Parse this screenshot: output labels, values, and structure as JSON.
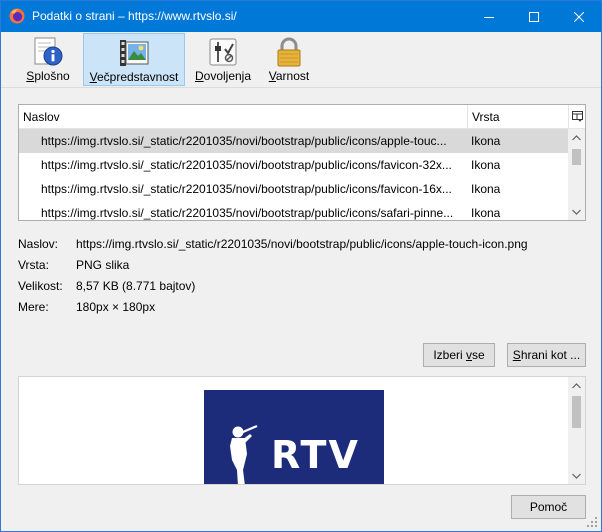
{
  "window": {
    "title": "Podatki o strani – https://www.rtvslo.si/",
    "accent": "#0078d7"
  },
  "tabs": [
    {
      "label_pre": "",
      "label_u": "S",
      "label_post": "plošno",
      "icon": "info-icon"
    },
    {
      "label_pre": "",
      "label_u": "V",
      "label_post": "ečpredstavnost",
      "icon": "media-icon"
    },
    {
      "label_pre": "",
      "label_u": "D",
      "label_post": "ovoljenja",
      "icon": "permissions-icon"
    },
    {
      "label_pre": "",
      "label_u": "V",
      "label_post": "arnost",
      "icon": "lock-icon"
    }
  ],
  "media_list": {
    "columns": [
      "Naslov",
      "Vrsta"
    ],
    "rows": [
      {
        "address": "https://img.rtvslo.si/_static/r2201035/novi/bootstrap/public/icons/apple-touc...",
        "type": "Ikona"
      },
      {
        "address": "https://img.rtvslo.si/_static/r2201035/novi/bootstrap/public/icons/favicon-32x...",
        "type": "Ikona"
      },
      {
        "address": "https://img.rtvslo.si/_static/r2201035/novi/bootstrap/public/icons/favicon-16x...",
        "type": "Ikona"
      },
      {
        "address": "https://img.rtvslo.si/_static/r2201035/novi/bootstrap/public/icons/safari-pinne...",
        "type": "Ikona"
      }
    ]
  },
  "details": {
    "address_label": "Naslov:",
    "address_value": "https://img.rtvslo.si/_static/r2201035/novi/bootstrap/public/icons/apple-touch-icon.png",
    "type_label": "Vrsta:",
    "type_value": "PNG slika",
    "size_label": "Velikost:",
    "size_value": "8,57 KB (8.771 bajtov)",
    "dims_label": "Mere:",
    "dims_value": "180px × 180px"
  },
  "buttons": {
    "select_all_pre": "Izberi ",
    "select_all_u": "v",
    "select_all_post": "se",
    "save_as_pre": "",
    "save_as_u": "S",
    "save_as_post": "hrani kot ...",
    "help": "Pomoč"
  },
  "preview": {
    "logo_text": "RTV",
    "logo_bg": "#1c2c7a"
  }
}
